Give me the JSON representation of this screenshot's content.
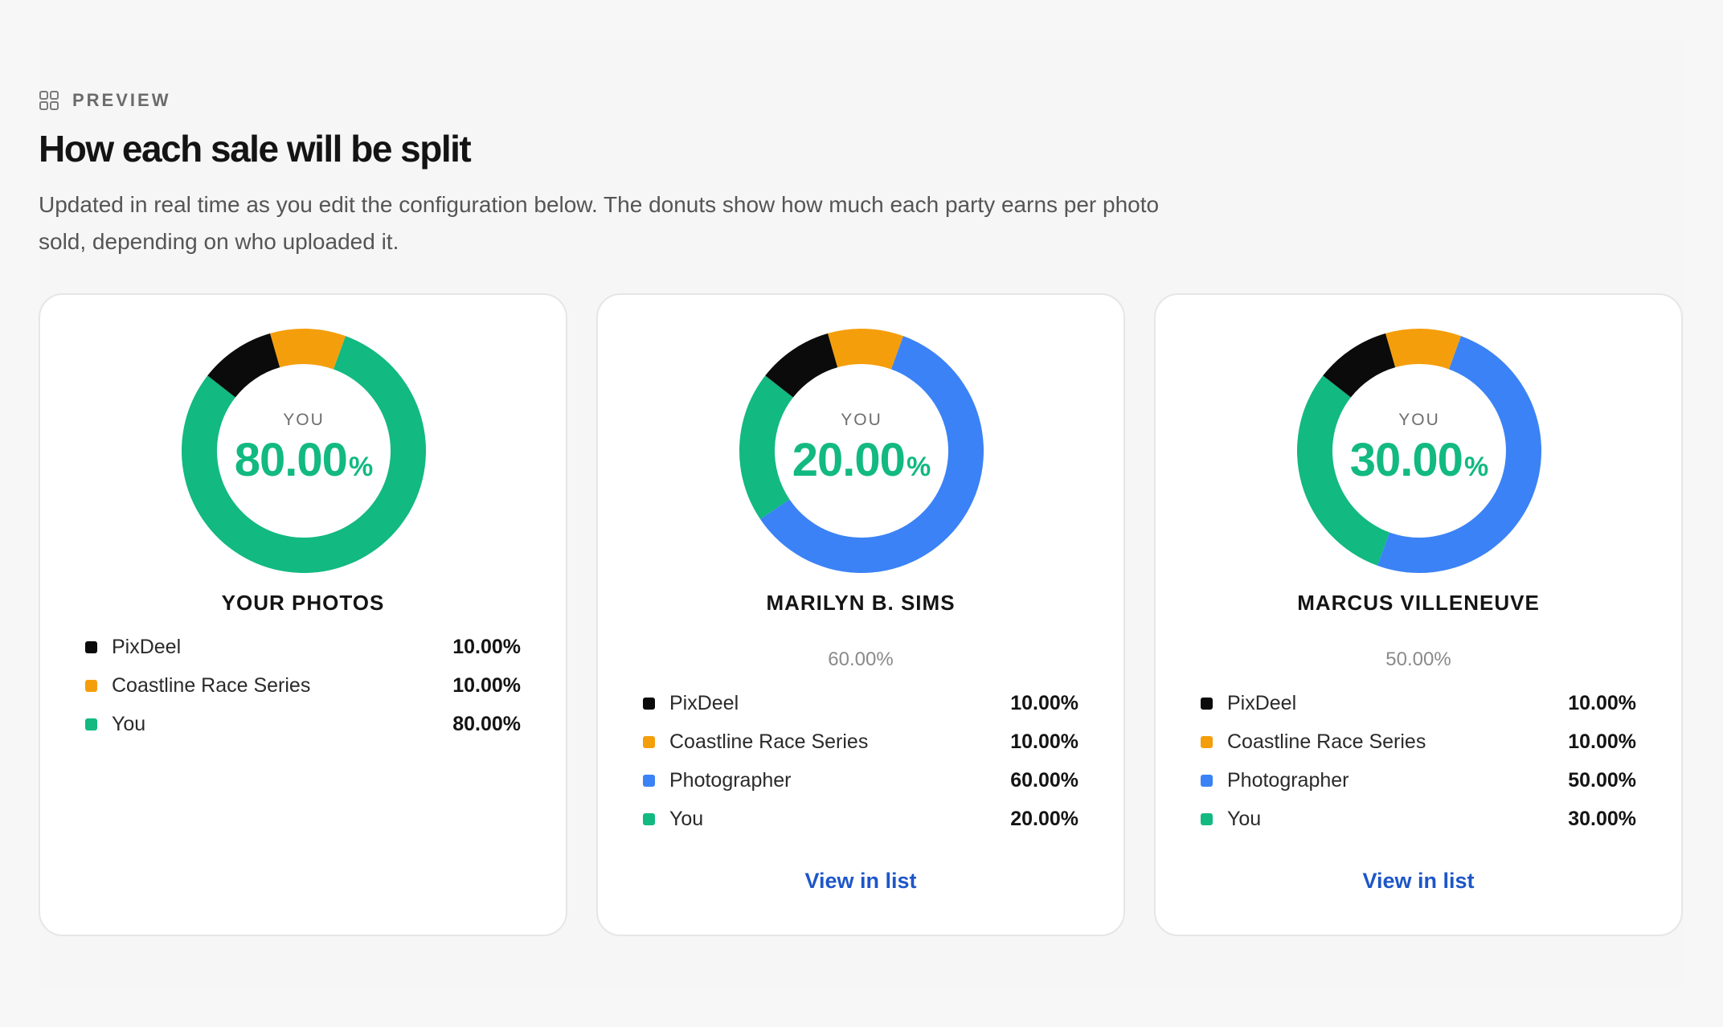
{
  "header": {
    "eyebrow_icon": "grid-icon",
    "eyebrow": "PREVIEW",
    "title": "How each sale will be split",
    "subtitle": "Updated in real time as you edit the configuration below. The donuts show how much each party earns per photo sold, depending on who uploaded it."
  },
  "colors": {
    "pixdeel": "#0b0b0b",
    "coastline": "#f59e0b",
    "photographer": "#3b82f6",
    "you": "#12b981",
    "link": "#1d56c8"
  },
  "cards": [
    {
      "name": "YOUR PHOTOS",
      "center_label": "YOU",
      "center_value": "80.00",
      "center_unit": "%",
      "share": "",
      "link": "",
      "segments": [
        {
          "label": "PixDeel",
          "value": "10.00%",
          "percent": 10,
          "color": "#0b0b0b"
        },
        {
          "label": "Coastline Race Series",
          "value": "10.00%",
          "percent": 10,
          "color": "#f59e0b"
        },
        {
          "label": "You",
          "value": "80.00%",
          "percent": 80,
          "color": "#12b981"
        }
      ]
    },
    {
      "name": "MARILYN B. SIMS",
      "center_label": "YOU",
      "center_value": "20.00",
      "center_unit": "%",
      "share": "60.00%",
      "link": "View in list",
      "segments": [
        {
          "label": "PixDeel",
          "value": "10.00%",
          "percent": 10,
          "color": "#0b0b0b"
        },
        {
          "label": "Coastline Race Series",
          "value": "10.00%",
          "percent": 10,
          "color": "#f59e0b"
        },
        {
          "label": "Photographer",
          "value": "60.00%",
          "percent": 60,
          "color": "#3b82f6"
        },
        {
          "label": "You",
          "value": "20.00%",
          "percent": 20,
          "color": "#12b981"
        }
      ]
    },
    {
      "name": "MARCUS VILLENEUVE",
      "center_label": "YOU",
      "center_value": "30.00",
      "center_unit": "%",
      "share": "50.00%",
      "link": "View in list",
      "segments": [
        {
          "label": "PixDeel",
          "value": "10.00%",
          "percent": 10,
          "color": "#0b0b0b"
        },
        {
          "label": "Coastline Race Series",
          "value": "10.00%",
          "percent": 10,
          "color": "#f59e0b"
        },
        {
          "label": "Photographer",
          "value": "50.00%",
          "percent": 50,
          "color": "#3b82f6"
        },
        {
          "label": "You",
          "value": "30.00%",
          "percent": 30,
          "color": "#12b981"
        }
      ]
    }
  ]
}
